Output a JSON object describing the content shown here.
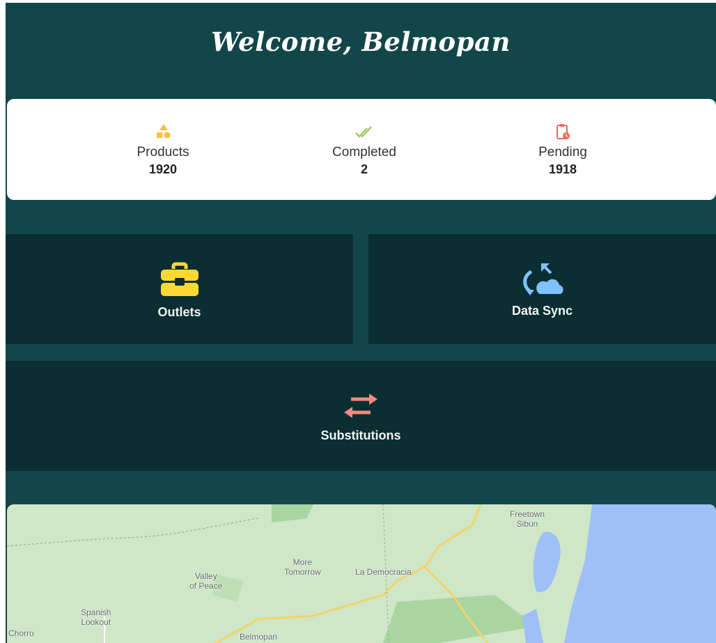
{
  "header": {
    "title": "Welcome, Belmopan"
  },
  "stats": [
    {
      "label": "Products",
      "value": "1920",
      "icon": "shapes-icon",
      "color": "#f4c33a"
    },
    {
      "label": "Completed",
      "value": "2",
      "icon": "double-check-icon",
      "color": "#8bc34a"
    },
    {
      "label": "Pending",
      "value": "1918",
      "icon": "clipboard-clock-icon",
      "color": "#ef6b5b"
    }
  ],
  "tiles": {
    "outlets": {
      "label": "Outlets",
      "icon": "briefcase-icon",
      "color": "#fdd835"
    },
    "data_sync": {
      "label": "Data Sync",
      "icon": "cloud-sync-icon",
      "color": "#7ec3ff"
    },
    "substitutions": {
      "label": "Substitutions",
      "icon": "swap-arrows-icon",
      "color": "#f08a80"
    }
  },
  "map": {
    "places": [
      {
        "id": "freetown",
        "name": "Freetown\nSibun"
      },
      {
        "id": "more-tomorrow",
        "name": "More\nTomorrow"
      },
      {
        "id": "la-democracia",
        "name": "La Democracia"
      },
      {
        "id": "valley-of-peace",
        "name": "Valley\nof Peace"
      },
      {
        "id": "spanish-lookout",
        "name": "Spanish\nLookout"
      },
      {
        "id": "chorro",
        "name": "Chorro"
      },
      {
        "id": "belmopan",
        "name": "Belmopan"
      }
    ],
    "colors": {
      "land": "#cfe6c7",
      "forest": "#a8d5a0",
      "water": "#9ebff7",
      "road": "#f2d36b"
    }
  }
}
